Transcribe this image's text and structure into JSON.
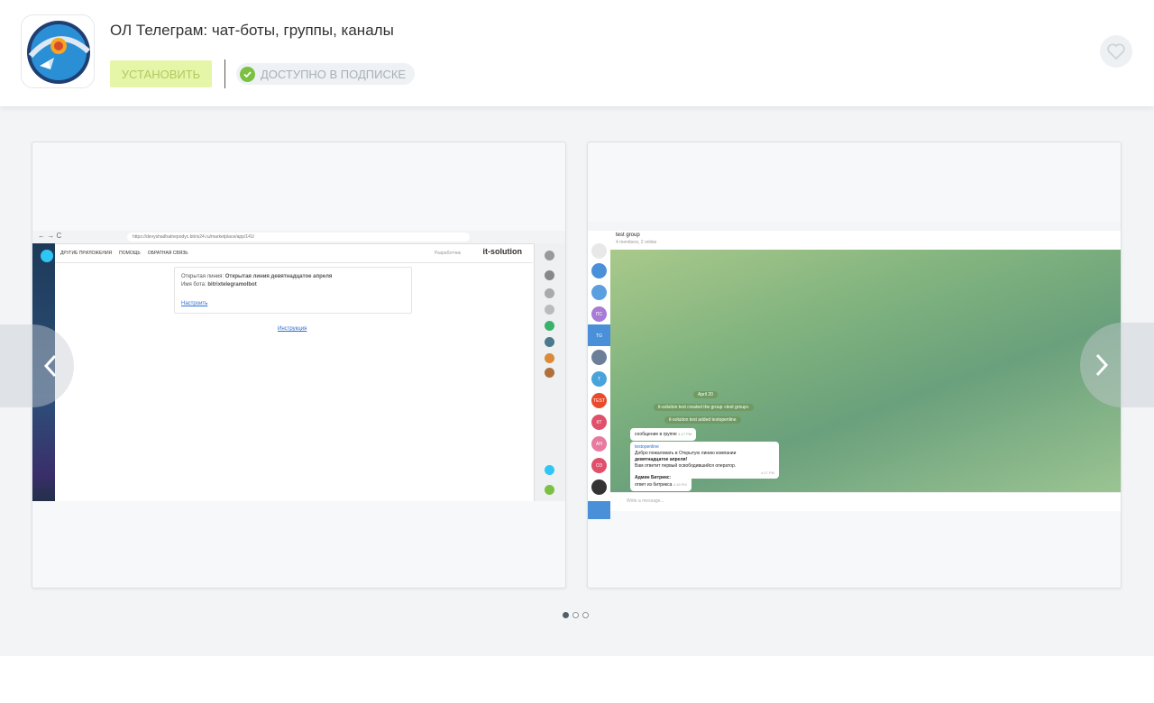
{
  "app": {
    "title": "ОЛ Телеграм: чат-боты, группы, каналы",
    "install_label": "Установить",
    "subscription_label": "Доступно в подписке"
  },
  "colors": {
    "install_bg": "#e6f6a8",
    "check": "#7bc043",
    "accent_blue": "#2f6fd1"
  },
  "icons": {
    "favorite": "heart-icon",
    "check": "check-circle-icon",
    "prev": "chevron-left-icon",
    "next": "chevron-right-icon"
  },
  "gallery": {
    "active_index": 0,
    "count": 3
  },
  "screenshot_left": {
    "url": "https://devyshadhatnepodyc.bitrix24.ru/marketplace/app/141/",
    "menu": [
      "ДРУГИЕ ПРИЛОЖЕНИЯ",
      "ПОМОЩЬ",
      "ОБРАТНАЯ СВЯЗЬ"
    ],
    "menu_right": "Разработчик",
    "brand": "it-solution",
    "line_label": "Открытая линия:",
    "line_value": "Открытая линия девятнадцатое апреля",
    "bot_label": "Имя бота:",
    "bot_value": "bitrixtelegramolbot",
    "settings_link": "Настроить",
    "instruction_link": "Инструкция"
  },
  "screenshot_right": {
    "chat_title": "test group",
    "chat_subtitle": "4 members, 2 online",
    "date_pill": "April 20",
    "events": [
      "it-solution test created the group «test group»",
      "it-solution test added testopenline"
    ],
    "msg1": "сообщение в группе",
    "msg1_time": "4:17 PM",
    "msg2_sender": "testopenline",
    "msg2_line1": "Добро пожаловать в Открытую линию компании",
    "msg2_line2": "девятнадцатое апреля!",
    "msg2_line3": "Вам ответит первый освободившийся оператор.",
    "msg2_time": "4:17 PM",
    "msg3_sender": "Админ Битрикс:",
    "msg3_text": "ответ из битрикса",
    "msg3_time": "4:18 PM",
    "input_placeholder": "Write a message...",
    "avatars": [
      "ПС",
      "TG",
      "Т",
      "TEST",
      "КТ",
      "АН",
      "ОЗ"
    ]
  }
}
